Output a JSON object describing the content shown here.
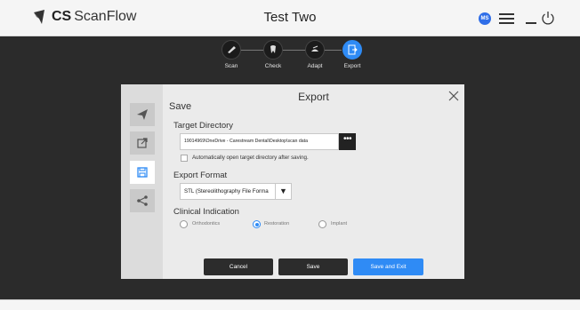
{
  "app": {
    "logo_cs": "CS",
    "logo_name": "ScanFlow",
    "title": "Test Two",
    "user_initials": "MS"
  },
  "workflow": {
    "steps": [
      {
        "label": "Scan",
        "icon": "scan-icon"
      },
      {
        "label": "Check",
        "icon": "check-icon"
      },
      {
        "label": "Adapt",
        "icon": "adapt-icon"
      },
      {
        "label": "Export",
        "icon": "export-icon",
        "active": true
      }
    ]
  },
  "dialog": {
    "title": "Export",
    "section_title": "Save",
    "target_directory_label": "Target Directory",
    "target_directory_value": "19014969\\OneDrive - Carestream Dental\\Desktop\\scan data",
    "browse_label": "•••",
    "auto_open_label": "Automatically open target directory after saving.",
    "auto_open_checked": false,
    "export_format_label": "Export Format",
    "export_format_value": "STL (Stereolithography File Forma",
    "clinical_indication_label": "Clinical Indication",
    "indications": [
      {
        "label": "Orthodontics",
        "checked": false
      },
      {
        "label": "Restoration",
        "checked": true
      },
      {
        "label": "Implant",
        "checked": false
      }
    ],
    "buttons": {
      "cancel": "Cancel",
      "save": "Save",
      "save_exit": "Save and Exit"
    }
  },
  "colors": {
    "accent": "#2f8bf5",
    "workspace": "#2b2b2b",
    "dialog_bg": "#ebebeb"
  }
}
